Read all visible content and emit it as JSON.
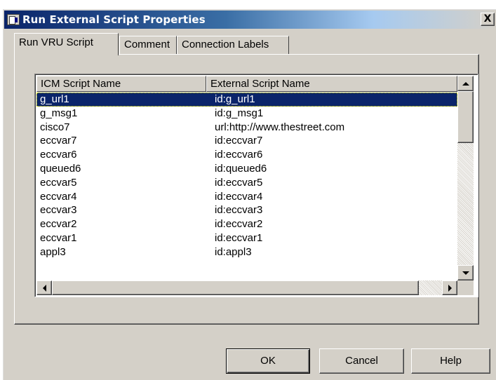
{
  "window": {
    "title": "Run External Script Properties",
    "close_glyph": "X"
  },
  "tabs": [
    {
      "label": "Run VRU Script",
      "active": true
    },
    {
      "label": "Comment",
      "active": false
    },
    {
      "label": "Connection Labels",
      "active": false
    }
  ],
  "list": {
    "columns": [
      "ICM Script Name",
      "External Script Name"
    ],
    "rows": [
      {
        "icm": "g_url1",
        "external": "id:g_url1",
        "selected": true
      },
      {
        "icm": "g_msg1",
        "external": "id:g_msg1",
        "selected": false
      },
      {
        "icm": "cisco7",
        "external": "url:http://www.thestreet.com",
        "selected": false
      },
      {
        "icm": "eccvar7",
        "external": "id:eccvar7",
        "selected": false
      },
      {
        "icm": "eccvar6",
        "external": "id:eccvar6",
        "selected": false
      },
      {
        "icm": "queued6",
        "external": "id:queued6",
        "selected": false
      },
      {
        "icm": "eccvar5",
        "external": "id:eccvar5",
        "selected": false
      },
      {
        "icm": "eccvar4",
        "external": "id:eccvar4",
        "selected": false
      },
      {
        "icm": "eccvar3",
        "external": "id:eccvar3",
        "selected": false
      },
      {
        "icm": "eccvar2",
        "external": "id:eccvar2",
        "selected": false
      },
      {
        "icm": "eccvar1",
        "external": "id:eccvar1",
        "selected": false
      },
      {
        "icm": "appl3",
        "external": "id:appl3",
        "selected": false
      }
    ]
  },
  "buttons": {
    "ok": "OK",
    "cancel": "Cancel",
    "help": "Help"
  },
  "icons": {
    "app": "dialog-app-icon",
    "close": "close-icon",
    "scroll_up": "scroll-up-arrow-icon",
    "scroll_down": "scroll-down-arrow-icon",
    "scroll_left": "scroll-left-arrow-icon",
    "scroll_right": "scroll-right-arrow-icon"
  },
  "colors": {
    "selection": "#0a246a",
    "face": "#d4d0c8"
  }
}
